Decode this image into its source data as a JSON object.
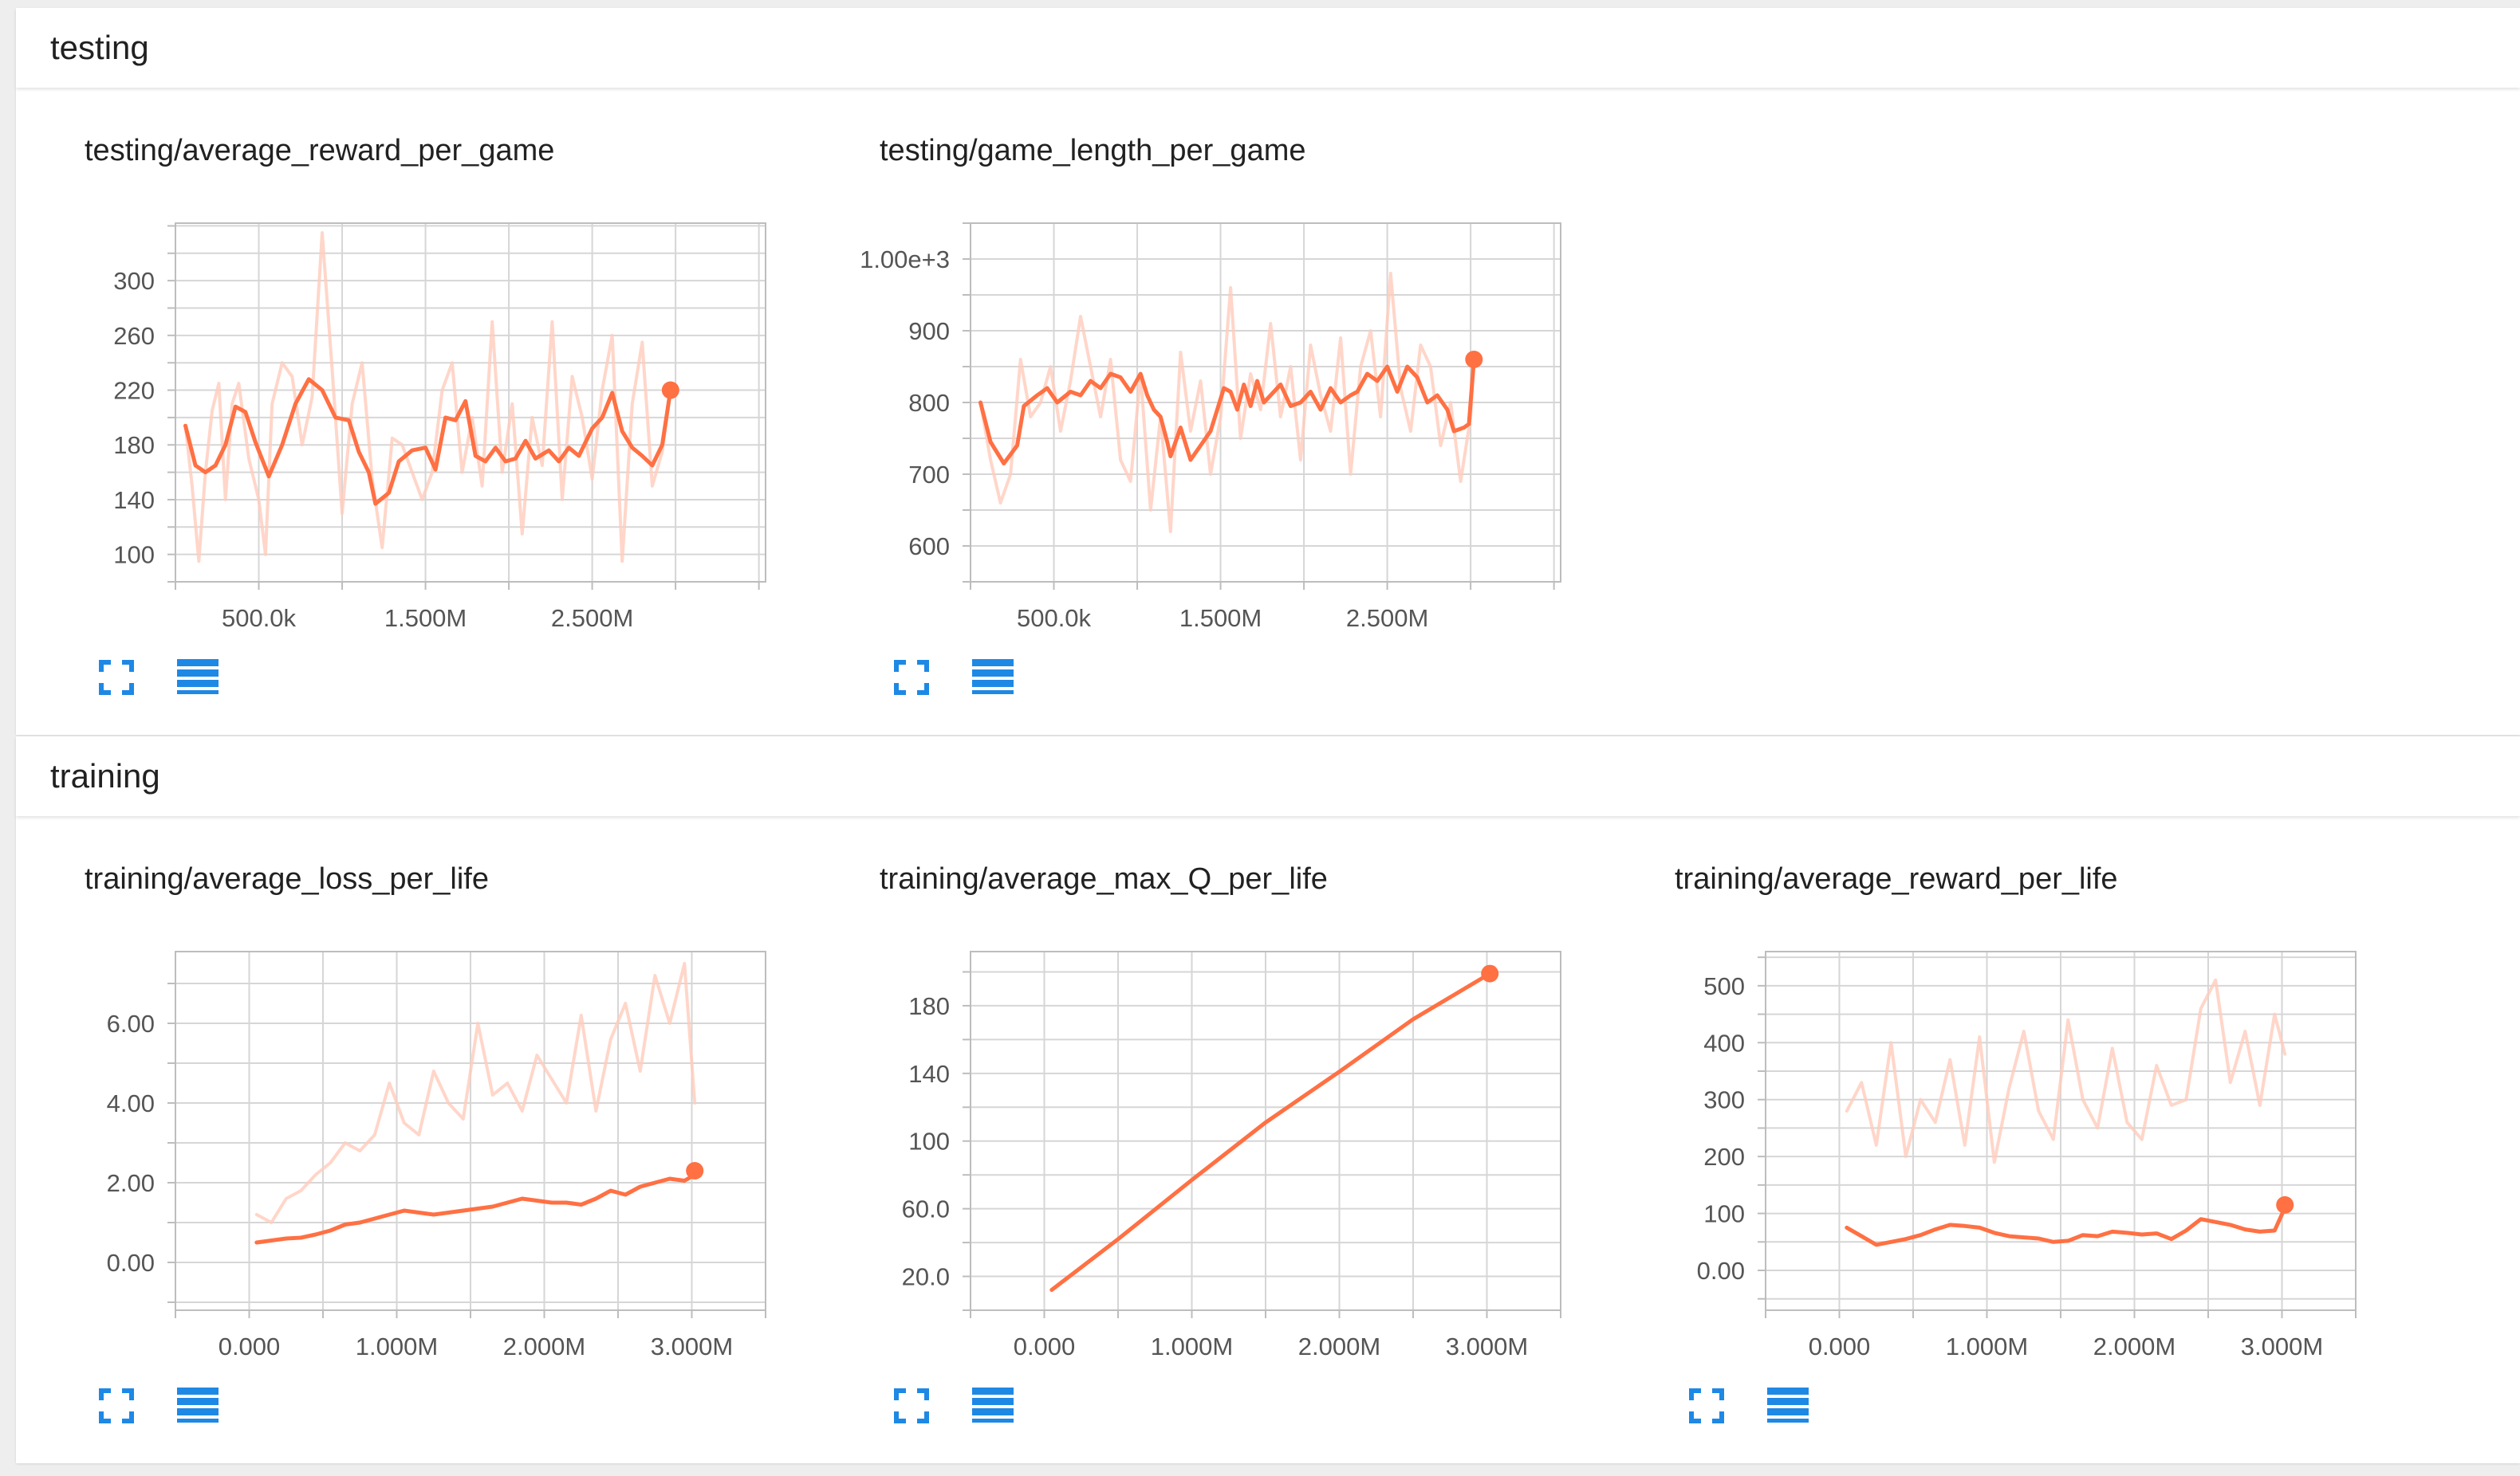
{
  "sections": [
    {
      "title": "testing"
    },
    {
      "title": "training"
    }
  ],
  "colors": {
    "line": "#ff7043",
    "raw": "#ffccbc",
    "grid": "#d6d6d6",
    "axis": "#bdbdbd",
    "icon": "#1e88e5"
  },
  "icons": {
    "expand": "fullscreen-icon",
    "data": "list-icon"
  },
  "charts": [
    {
      "title": "testing/average_reward_per_game",
      "chart_data": {
        "type": "line",
        "title": "testing/average_reward_per_game",
        "xlim": [
          0,
          3540000
        ],
        "ylim": [
          80,
          342
        ],
        "xticks": [
          500000,
          1500000,
          2500000
        ],
        "xtick_labels": [
          "500.0k",
          "1.500M",
          "2.500M"
        ],
        "yticks": [
          100,
          140,
          180,
          220,
          260,
          300
        ],
        "ytick_labels": [
          "100",
          "140",
          "180",
          "220",
          "260",
          "300"
        ],
        "grid": true,
        "series": [
          {
            "role": "smoothed",
            "x": [
              60000,
              120000,
              180000,
              240000,
              300000,
              360000,
              420000,
              480000,
              560000,
              640000,
              720000,
              800000,
              880000,
              960000,
              1040000,
              1100000,
              1160000,
              1200000,
              1280000,
              1340000,
              1420000,
              1500000,
              1560000,
              1620000,
              1680000,
              1740000,
              1800000,
              1860000,
              1920000,
              1980000,
              2040000,
              2100000,
              2160000,
              2240000,
              2300000,
              2360000,
              2420000,
              2500000,
              2560000,
              2620000,
              2680000,
              2740000,
              2800000,
              2860000,
              2920000,
              2970000
            ],
            "y": [
              194,
              165,
              160,
              165,
              180,
              208,
              204,
              182,
              157,
              180,
              210,
              228,
              220,
              200,
              198,
              175,
              160,
              137,
              145,
              168,
              176,
              178,
              162,
              200,
              198,
              212,
              172,
              168,
              178,
              168,
              170,
              183,
              170,
              176,
              168,
              178,
              172,
              192,
              200,
              218,
              190,
              178,
              172,
              165,
              180,
              220
            ]
          },
          {
            "role": "raw",
            "x": [
              60000,
              100000,
              140000,
              180000,
              220000,
              260000,
              300000,
              340000,
              380000,
              440000,
              500000,
              540000,
              580000,
              640000,
              700000,
              760000,
              820000,
              880000,
              940000,
              1000000,
              1060000,
              1120000,
              1180000,
              1240000,
              1300000,
              1360000,
              1420000,
              1480000,
              1540000,
              1600000,
              1660000,
              1720000,
              1780000,
              1840000,
              1900000,
              1960000,
              2020000,
              2080000,
              2140000,
              2200000,
              2260000,
              2320000,
              2380000,
              2440000,
              2500000,
              2560000,
              2620000,
              2680000,
              2740000,
              2800000,
              2860000,
              2920000,
              2970000
            ],
            "y": [
              194,
              150,
              95,
              160,
              205,
              225,
              140,
              210,
              225,
              170,
              140,
              100,
              210,
              240,
              230,
              180,
              215,
              335,
              235,
              130,
              210,
              240,
              155,
              105,
              185,
              180,
              160,
              140,
              160,
              220,
              240,
              160,
              200,
              150,
              270,
              160,
              210,
              115,
              200,
              165,
              270,
              140,
              230,
              200,
              155,
              220,
              260,
              95,
              210,
              255,
              150,
              175,
              220
            ]
          }
        ],
        "last_point": {
          "x": 2970000,
          "y": 220
        }
      }
    },
    {
      "title": "testing/game_length_per_game",
      "chart_data": {
        "type": "line",
        "title": "testing/game_length_per_game",
        "xlim": [
          0,
          3540000
        ],
        "ylim": [
          550,
          1050
        ],
        "xticks": [
          500000,
          1500000,
          2500000
        ],
        "xtick_labels": [
          "500.0k",
          "1.500M",
          "2.500M"
        ],
        "yticks": [
          600,
          700,
          800,
          900,
          1000
        ],
        "ytick_labels": [
          "600",
          "700",
          "800",
          "900",
          "1.00e+3"
        ],
        "grid": true,
        "series": [
          {
            "role": "smoothed",
            "x": [
              60000,
              120000,
              200000,
              280000,
              320000,
              400000,
              460000,
              520000,
              600000,
              660000,
              720000,
              780000,
              840000,
              900000,
              960000,
              1020000,
              1060000,
              1100000,
              1140000,
              1180000,
              1200000,
              1260000,
              1320000,
              1380000,
              1440000,
              1480000,
              1520000,
              1560000,
              1600000,
              1640000,
              1680000,
              1720000,
              1760000,
              1800000,
              1860000,
              1920000,
              1980000,
              2040000,
              2100000,
              2160000,
              2220000,
              2280000,
              2320000,
              2380000,
              2440000,
              2500000,
              2560000,
              2620000,
              2680000,
              2740000,
              2800000,
              2860000,
              2900000,
              2960000,
              2990000,
              3020000
            ],
            "y": [
              800,
              745,
              715,
              740,
              795,
              810,
              820,
              800,
              815,
              810,
              830,
              820,
              840,
              835,
              815,
              840,
              810,
              790,
              780,
              745,
              725,
              765,
              720,
              740,
              760,
              790,
              820,
              815,
              790,
              825,
              795,
              830,
              800,
              810,
              825,
              795,
              800,
              815,
              790,
              820,
              800,
              810,
              815,
              840,
              830,
              850,
              815,
              850,
              835,
              800,
              810,
              790,
              760,
              765,
              770,
              860
            ]
          },
          {
            "role": "raw",
            "x": [
              60000,
              120000,
              180000,
              240000,
              300000,
              360000,
              420000,
              480000,
              540000,
              600000,
              660000,
              720000,
              780000,
              840000,
              900000,
              960000,
              1020000,
              1080000,
              1140000,
              1200000,
              1260000,
              1320000,
              1380000,
              1440000,
              1500000,
              1560000,
              1620000,
              1680000,
              1740000,
              1800000,
              1860000,
              1920000,
              1980000,
              2040000,
              2100000,
              2160000,
              2220000,
              2280000,
              2340000,
              2400000,
              2460000,
              2520000,
              2580000,
              2640000,
              2700000,
              2760000,
              2820000,
              2880000,
              2940000,
              3000000,
              3020000
            ],
            "y": [
              800,
              720,
              660,
              700,
              860,
              780,
              800,
              850,
              760,
              830,
              920,
              850,
              780,
              860,
              720,
              690,
              840,
              650,
              780,
              620,
              870,
              760,
              830,
              700,
              780,
              960,
              750,
              840,
              790,
              910,
              780,
              850,
              720,
              880,
              810,
              760,
              890,
              700,
              850,
              900,
              780,
              980,
              820,
              760,
              880,
              850,
              740,
              800,
              690,
              780,
              860
            ]
          }
        ],
        "last_point": {
          "x": 3020000,
          "y": 860
        }
      }
    },
    {
      "title": "training/average_loss_per_life",
      "chart_data": {
        "type": "line",
        "title": "training/average_loss_per_life",
        "xlim": [
          -500000,
          3500000
        ],
        "ylim": [
          -1.2,
          7.8
        ],
        "xticks": [
          0,
          1000000,
          2000000,
          3000000
        ],
        "xtick_labels": [
          "0.000",
          "1.000M",
          "2.000M",
          "3.000M"
        ],
        "yticks": [
          0,
          2,
          4,
          6
        ],
        "ytick_labels": [
          "0.00",
          "2.00",
          "4.00",
          "6.00"
        ],
        "grid": true,
        "series": [
          {
            "role": "smoothed",
            "x": [
              50000,
              150000,
              250000,
              350000,
              450000,
              550000,
              650000,
              750000,
              850000,
              950000,
              1050000,
              1150000,
              1250000,
              1350000,
              1450000,
              1550000,
              1650000,
              1750000,
              1850000,
              1950000,
              2050000,
              2150000,
              2250000,
              2350000,
              2450000,
              2550000,
              2650000,
              2750000,
              2850000,
              2950000,
              3020000
            ],
            "y": [
              0.5,
              0.55,
              0.6,
              0.62,
              0.7,
              0.8,
              0.95,
              1.0,
              1.1,
              1.2,
              1.3,
              1.25,
              1.2,
              1.25,
              1.3,
              1.35,
              1.4,
              1.5,
              1.6,
              1.55,
              1.5,
              1.5,
              1.45,
              1.6,
              1.8,
              1.7,
              1.9,
              2.0,
              2.1,
              2.05,
              2.2
            ]
          },
          {
            "role": "raw",
            "x": [
              50000,
              150000,
              250000,
              350000,
              450000,
              550000,
              650000,
              750000,
              850000,
              950000,
              1050000,
              1150000,
              1250000,
              1350000,
              1450000,
              1550000,
              1650000,
              1750000,
              1850000,
              1950000,
              2050000,
              2150000,
              2250000,
              2350000,
              2450000,
              2550000,
              2650000,
              2750000,
              2850000,
              2950000,
              3020000
            ],
            "y": [
              1.2,
              1.0,
              1.6,
              1.8,
              2.2,
              2.5,
              3.0,
              2.8,
              3.2,
              4.5,
              3.5,
              3.2,
              4.8,
              4.0,
              3.6,
              6.0,
              4.2,
              4.5,
              3.8,
              5.2,
              4.6,
              4.0,
              6.2,
              3.8,
              5.6,
              6.5,
              4.8,
              7.2,
              6.0,
              7.5,
              4.0
            ]
          }
        ],
        "last_point": {
          "x": 3020000,
          "y": 2.3
        }
      }
    },
    {
      "title": "training/average_max_Q_per_life",
      "chart_data": {
        "type": "line",
        "title": "training/average_max_Q_per_life",
        "xlim": [
          -500000,
          3500000
        ],
        "ylim": [
          0,
          212
        ],
        "xticks": [
          0,
          1000000,
          2000000,
          3000000
        ],
        "xtick_labels": [
          "0.000",
          "1.000M",
          "2.000M",
          "3.000M"
        ],
        "yticks": [
          20,
          60,
          100,
          140,
          180
        ],
        "ytick_labels": [
          "20.0",
          "60.0",
          "100",
          "140",
          "180"
        ],
        "grid": true,
        "series": [
          {
            "role": "smoothed",
            "x": [
              50000,
              500000,
              1000000,
              1500000,
              2000000,
              2500000,
              3020000
            ],
            "y": [
              12,
              42,
              77,
              111,
              141,
              172,
              199
            ]
          }
        ],
        "last_point": {
          "x": 3020000,
          "y": 199
        }
      }
    },
    {
      "title": "training/average_reward_per_life",
      "chart_data": {
        "type": "line",
        "title": "training/average_reward_per_life",
        "xlim": [
          -500000,
          3500000
        ],
        "ylim": [
          -70,
          560
        ],
        "xticks": [
          0,
          1000000,
          2000000,
          3000000
        ],
        "xtick_labels": [
          "0.000",
          "1.000M",
          "2.000M",
          "3.000M"
        ],
        "yticks": [
          0,
          100,
          200,
          300,
          400,
          500
        ],
        "ytick_labels": [
          "0.00",
          "100",
          "200",
          "300",
          "400",
          "500"
        ],
        "grid": true,
        "series": [
          {
            "role": "smoothed",
            "x": [
              50000,
              150000,
              250000,
              350000,
              450000,
              550000,
              650000,
              750000,
              850000,
              950000,
              1050000,
              1150000,
              1250000,
              1350000,
              1450000,
              1550000,
              1650000,
              1750000,
              1850000,
              1950000,
              2050000,
              2150000,
              2250000,
              2350000,
              2450000,
              2550000,
              2650000,
              2750000,
              2850000,
              2950000,
              3020000
            ],
            "y": [
              75,
              60,
              45,
              50,
              55,
              62,
              72,
              80,
              78,
              75,
              66,
              60,
              58,
              56,
              50,
              52,
              62,
              60,
              68,
              66,
              63,
              65,
              55,
              70,
              90,
              85,
              80,
              72,
              68,
              70,
              110
            ]
          },
          {
            "role": "raw",
            "x": [
              50000,
              150000,
              250000,
              350000,
              450000,
              550000,
              650000,
              750000,
              850000,
              950000,
              1050000,
              1150000,
              1250000,
              1350000,
              1450000,
              1550000,
              1650000,
              1750000,
              1850000,
              1950000,
              2050000,
              2150000,
              2250000,
              2350000,
              2450000,
              2550000,
              2650000,
              2750000,
              2850000,
              2950000,
              3020000
            ],
            "y": [
              280,
              330,
              220,
              400,
              200,
              300,
              260,
              370,
              220,
              410,
              190,
              320,
              420,
              280,
              230,
              440,
              300,
              250,
              390,
              260,
              230,
              360,
              290,
              300,
              460,
              510,
              330,
              420,
              290,
              450,
              380
            ]
          }
        ],
        "last_point": {
          "x": 3020000,
          "y": 115
        }
      }
    }
  ]
}
